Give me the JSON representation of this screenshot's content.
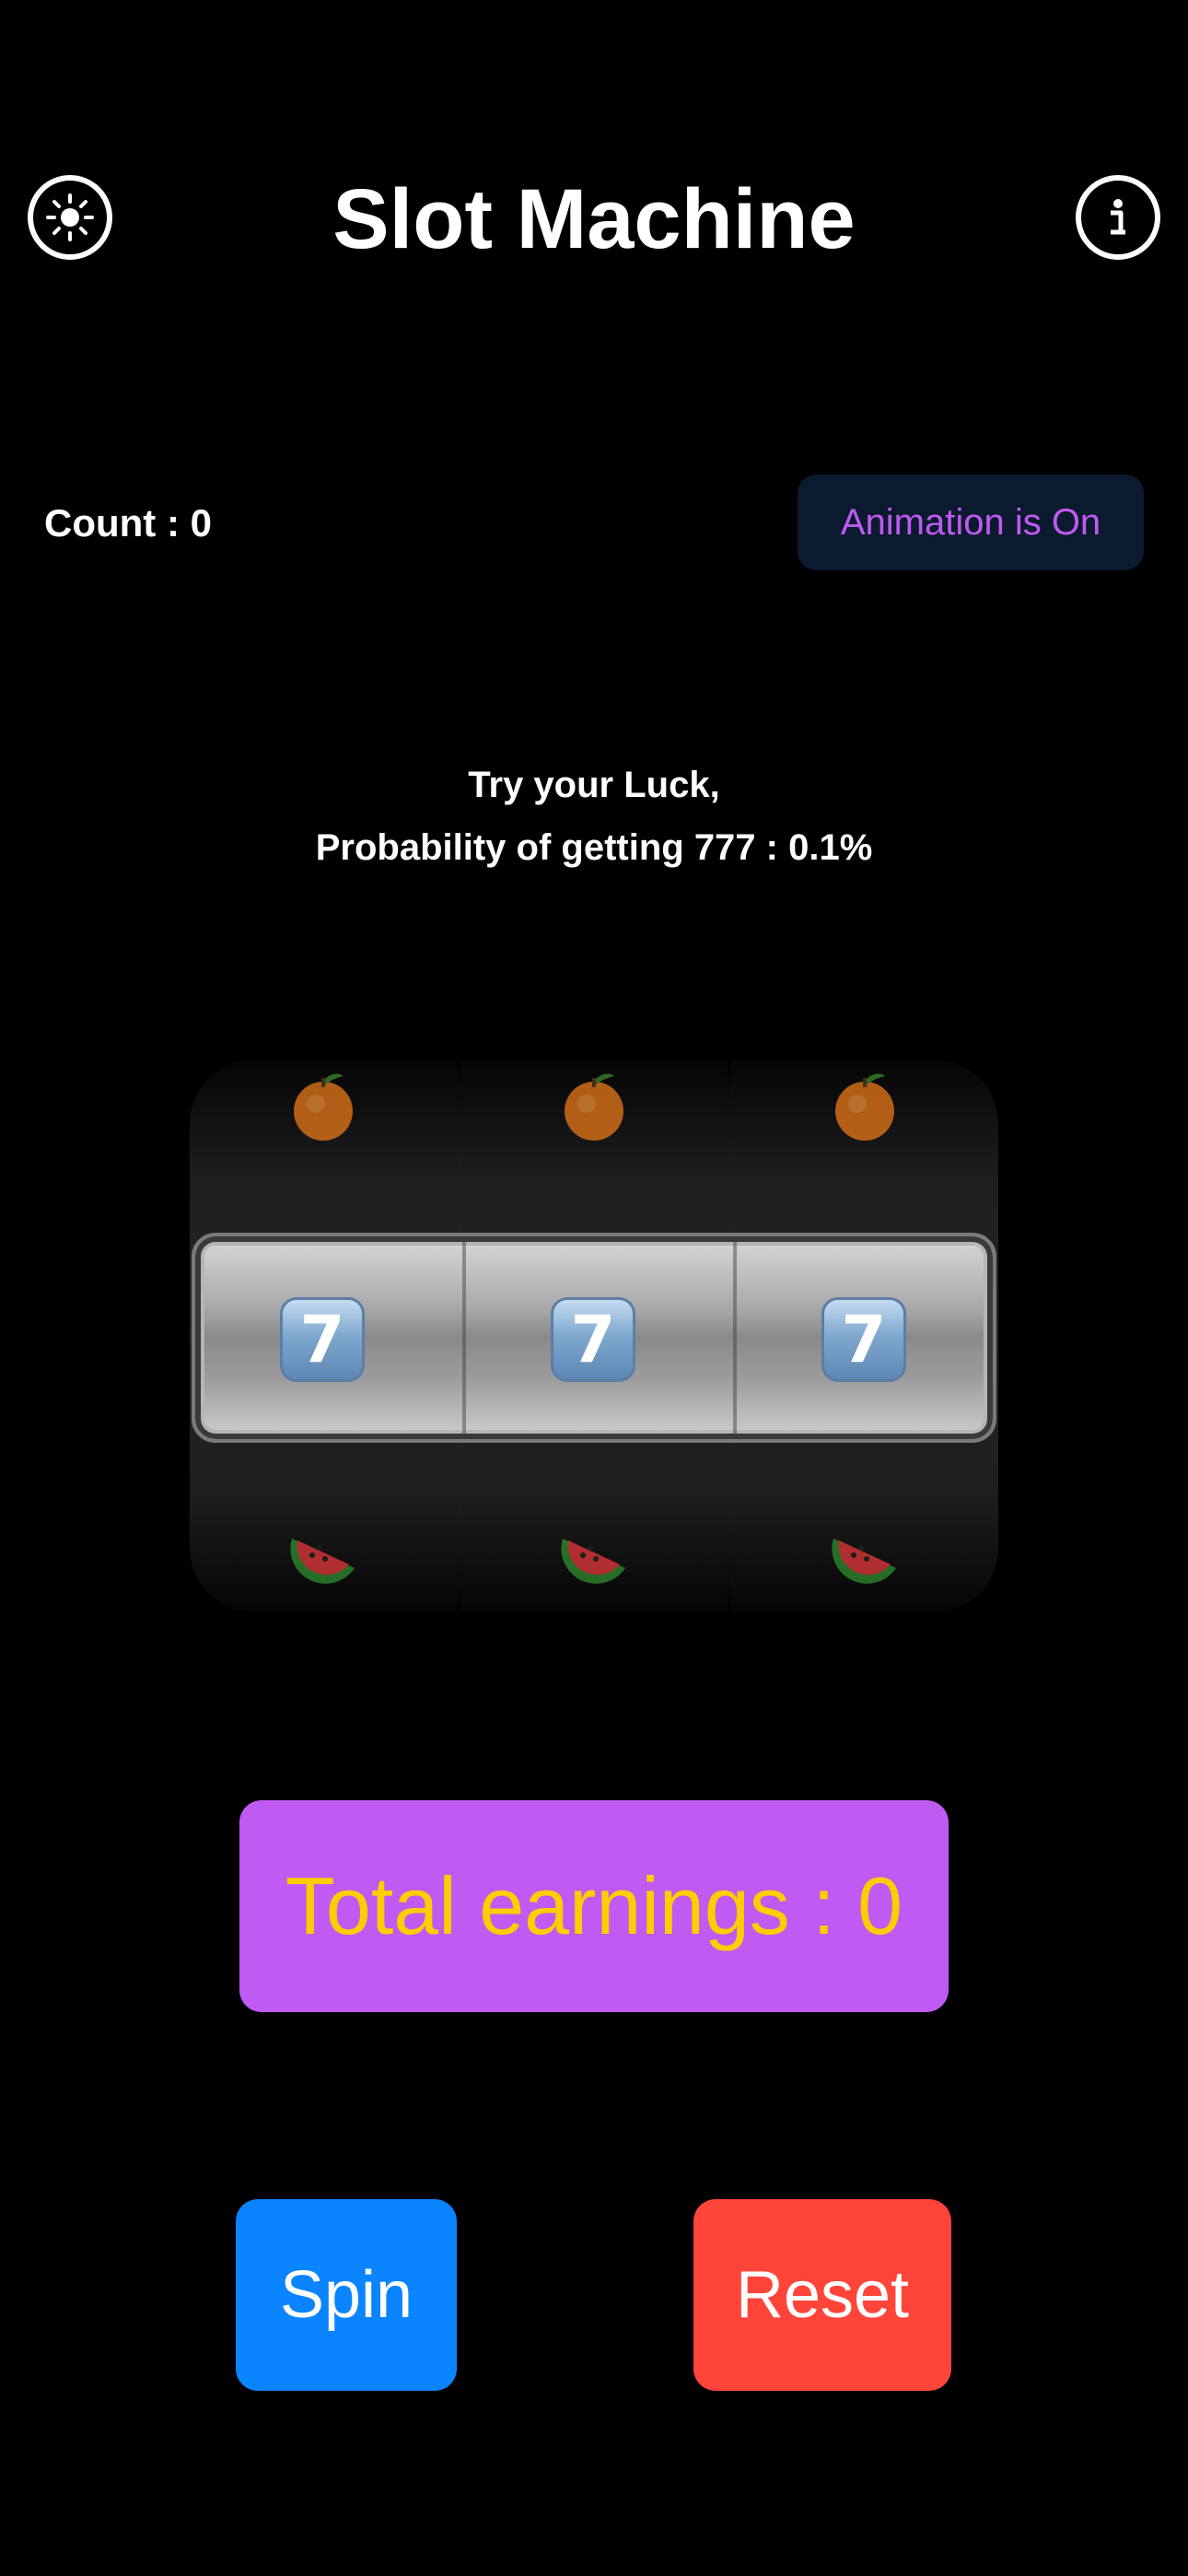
{
  "header": {
    "title": "Slot Machine",
    "left_icon": "brightness-icon",
    "right_icon": "info-icon"
  },
  "status": {
    "count_text": "Count : 0",
    "animation_label": "Animation is On"
  },
  "info": {
    "line1": "Try your Luck,",
    "line2": "Probability of getting 777 : 0.1%"
  },
  "reels": [
    {
      "top": "orange",
      "center": "7",
      "bottom": "watermelon"
    },
    {
      "top": "orange",
      "center": "7",
      "bottom": "watermelon"
    },
    {
      "top": "orange",
      "center": "7",
      "bottom": "watermelon"
    }
  ],
  "earnings": {
    "label": "Total earnings : 0"
  },
  "buttons": {
    "spin_label": "Spin",
    "reset_label": "Reset"
  },
  "colors": {
    "accent_purple": "#bf5af2",
    "earnings_text": "#ffcc00",
    "spin_blue": "#0a84ff",
    "reset_red": "#ff453a"
  }
}
